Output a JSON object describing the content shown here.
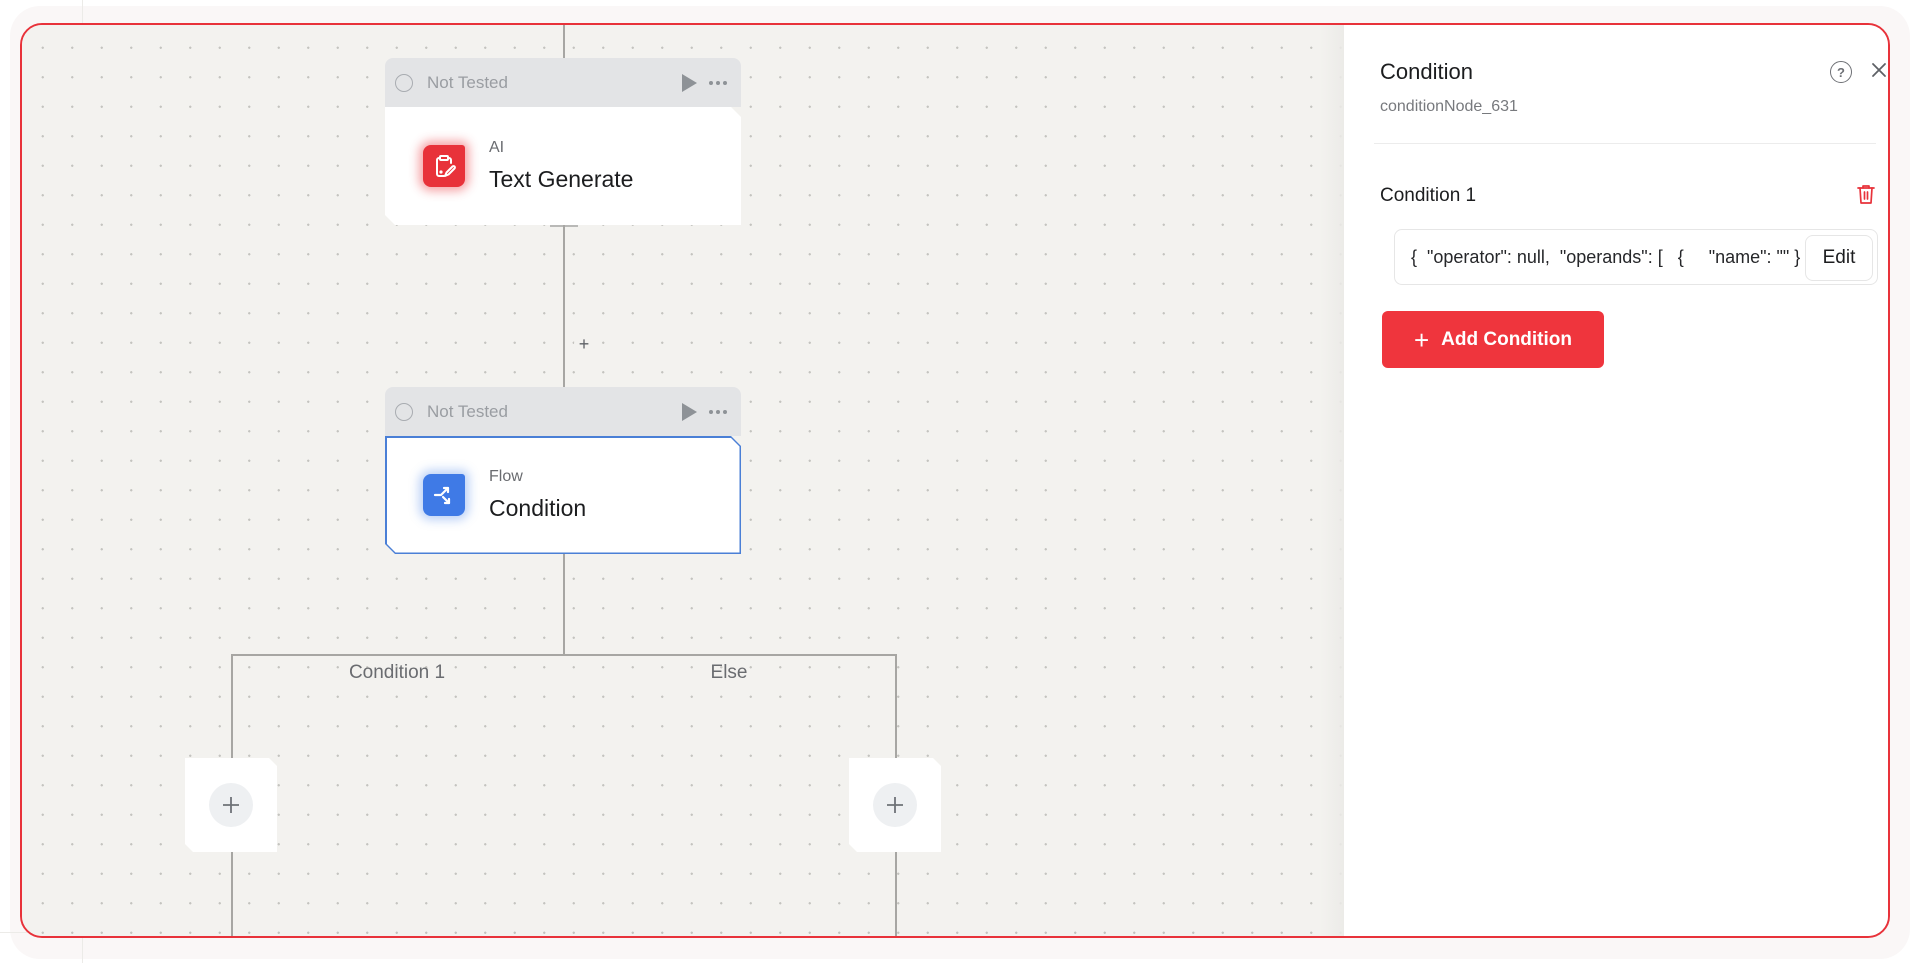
{
  "canvas": {
    "nodes": [
      {
        "status": "Not Tested",
        "category": "AI",
        "title": "Text Generate",
        "icon": "clipboard-pen-icon",
        "accent": "#e8323a",
        "selected": false
      },
      {
        "status": "Not Tested",
        "category": "Flow",
        "title": "Condition",
        "icon": "branch-split-icon",
        "accent": "#3f7ae6",
        "selected": true
      }
    ],
    "add_step_symbol": "+",
    "branches": [
      {
        "label": "Condition 1"
      },
      {
        "label": "Else"
      }
    ]
  },
  "panel": {
    "title": "Condition",
    "node_id": "conditionNode_631",
    "help_icon": "?",
    "conditions": [
      {
        "label": "Condition 1",
        "value": "{  \"operator\": null,  \"operands\": [   {     \"name\": \"\" } ] }",
        "edit_label": "Edit"
      }
    ],
    "add_condition_label": "Add Condition",
    "add_condition_symbol": "+"
  },
  "colors": {
    "brand_red": "#ef353d",
    "selection_blue": "#4a7fd6",
    "frame_red": "#e8323a"
  }
}
